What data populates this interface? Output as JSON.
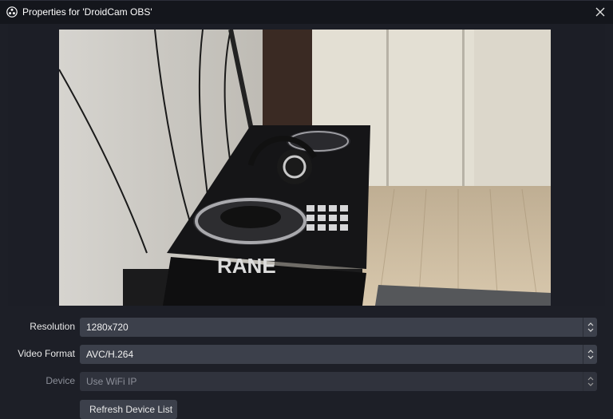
{
  "window": {
    "title": "Properties for 'DroidCam OBS'",
    "icon": "obs-logo-icon",
    "close_icon": "close-icon"
  },
  "preview": {
    "description_icon": "camera-preview",
    "logo_text": "RANE"
  },
  "fields": {
    "resolution": {
      "label": "Resolution",
      "value": "1280x720"
    },
    "video_format": {
      "label": "Video Format",
      "value": "AVC/H.264"
    },
    "device": {
      "label": "Device",
      "value": "Use WiFi IP",
      "disabled": true
    }
  },
  "buttons": {
    "refresh_label": "Refresh Device List"
  },
  "colors": {
    "background": "#1d1f27",
    "titlebar": "#14161c",
    "field": "#3c404b",
    "field_disabled": "#30333d"
  }
}
